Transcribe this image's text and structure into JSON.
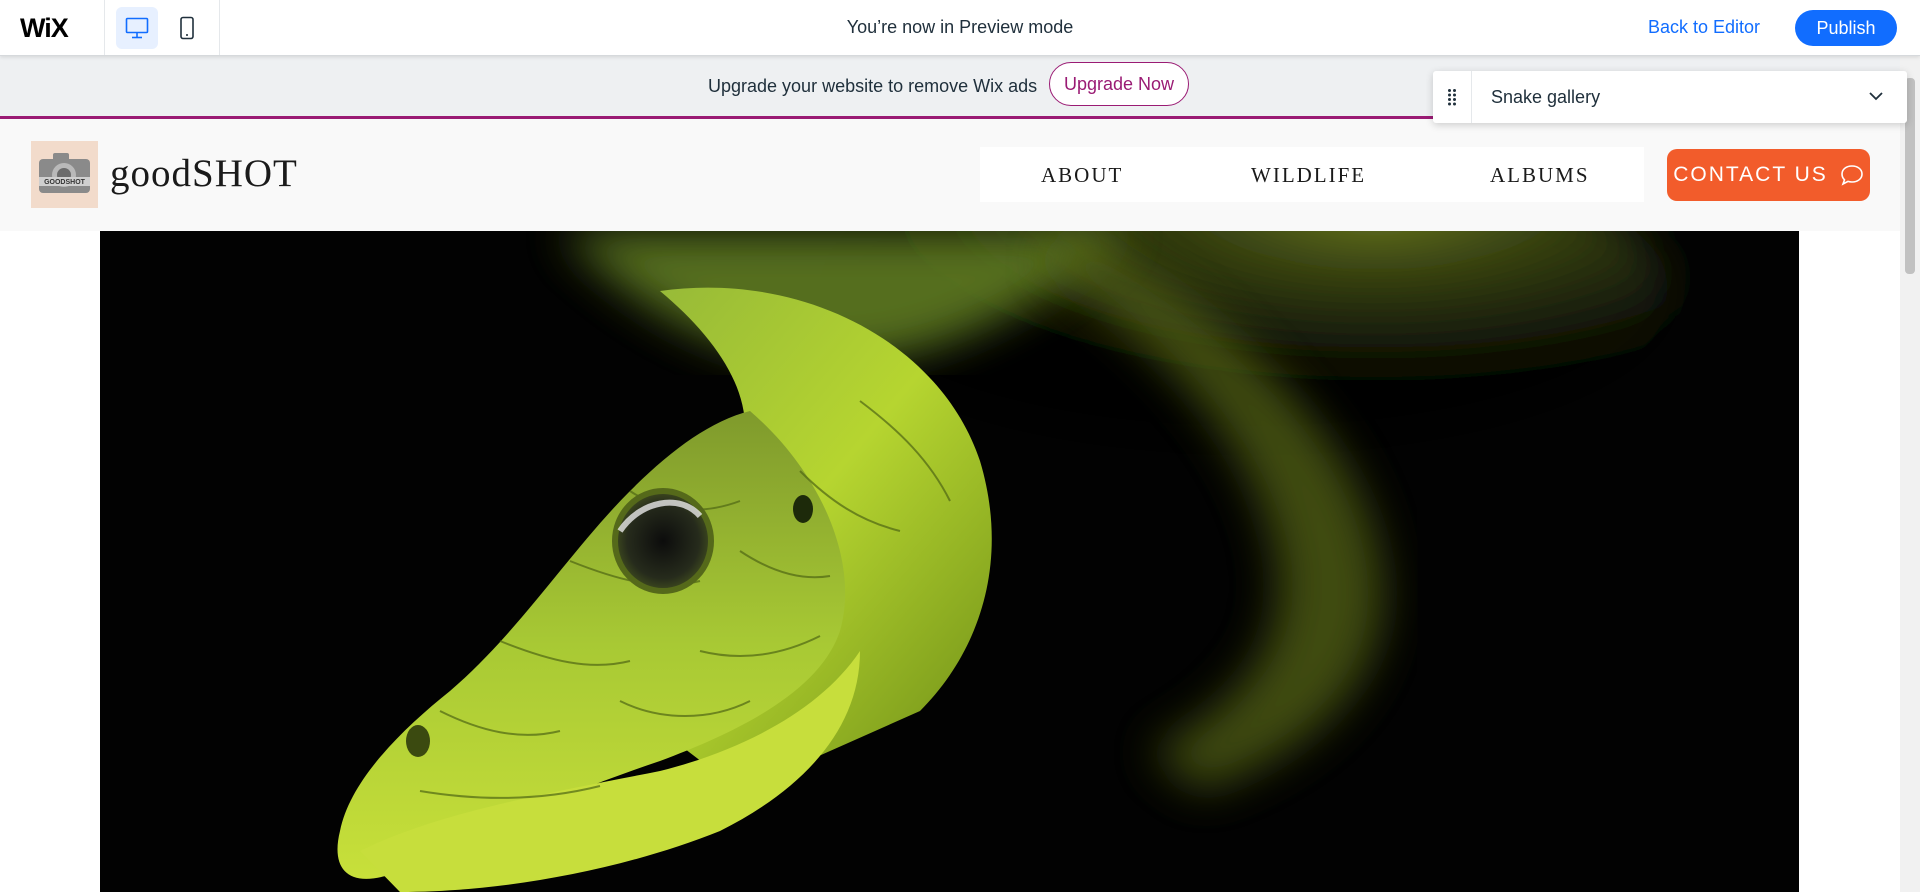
{
  "topbar": {
    "logo": "WiX",
    "device_desktop_icon": "desktop-icon",
    "device_mobile_icon": "mobile-icon",
    "preview_text": "You’re now in Preview mode",
    "back_label": "Back to Editor",
    "publish_label": "Publish"
  },
  "adbar": {
    "text": "Upgrade your website to remove Wix ads",
    "upgrade_label": "Upgrade Now"
  },
  "page_selector": {
    "selected": "Snake gallery"
  },
  "site": {
    "brand": "goodSHOT",
    "logo_text": "GOODSHOT",
    "nav": [
      "ABOUT",
      "WILDLIFE",
      "ALBUMS"
    ],
    "contact_label": "CONTACT US"
  },
  "colors": {
    "wix_blue": "#116dff",
    "upgrade_purple": "#9a1b74",
    "contact_orange": "#f25c2b"
  }
}
